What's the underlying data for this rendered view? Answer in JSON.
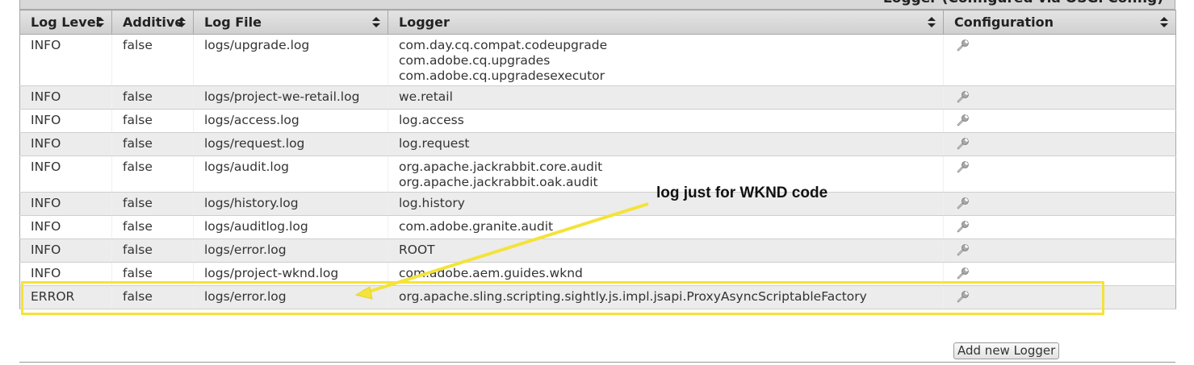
{
  "header": {
    "section_title": "Logger (Configured via OSGi Config)"
  },
  "table": {
    "columns": [
      "Log Level",
      "Additive",
      "Log File",
      "Logger",
      "Configuration"
    ],
    "rows": [
      {
        "level": "INFO",
        "additive": "false",
        "file": "logs/upgrade.log",
        "loggers": [
          "com.day.cq.compat.codeupgrade",
          "com.adobe.cq.upgrades",
          "com.adobe.cq.upgradesexecutor"
        ]
      },
      {
        "level": "INFO",
        "additive": "false",
        "file": "logs/project-we-retail.log",
        "loggers": [
          "we.retail"
        ]
      },
      {
        "level": "INFO",
        "additive": "false",
        "file": "logs/access.log",
        "loggers": [
          "log.access"
        ]
      },
      {
        "level": "INFO",
        "additive": "false",
        "file": "logs/request.log",
        "loggers": [
          "log.request"
        ]
      },
      {
        "level": "INFO",
        "additive": "false",
        "file": "logs/audit.log",
        "loggers": [
          "org.apache.jackrabbit.core.audit",
          "org.apache.jackrabbit.oak.audit"
        ]
      },
      {
        "level": "INFO",
        "additive": "false",
        "file": "logs/history.log",
        "loggers": [
          "log.history"
        ]
      },
      {
        "level": "INFO",
        "additive": "false",
        "file": "logs/auditlog.log",
        "loggers": [
          "com.adobe.granite.audit"
        ]
      },
      {
        "level": "INFO",
        "additive": "false",
        "file": "logs/error.log",
        "loggers": [
          "ROOT"
        ]
      },
      {
        "level": "INFO",
        "additive": "false",
        "file": "logs/project-wknd.log",
        "loggers": [
          "com.adobe.aem.guides.wknd"
        ]
      },
      {
        "level": "ERROR",
        "additive": "false",
        "file": "logs/error.log",
        "loggers": [
          "org.apache.sling.scripting.sightly.js.impl.jsapi.ProxyAsyncScriptableFactory"
        ]
      }
    ]
  },
  "footer": {
    "add_button_label": "Add new Logger"
  },
  "annotation": {
    "text": "log just for WKND code",
    "highlight_color": "#f4e33a"
  },
  "icons": {
    "configuration": "wrench-icon",
    "sort": "sort-arrows-icon"
  }
}
